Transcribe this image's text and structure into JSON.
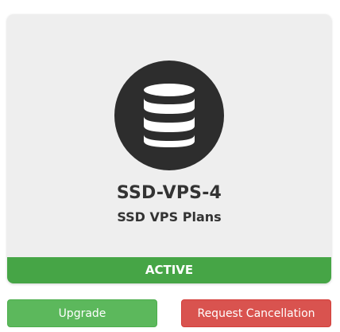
{
  "product": {
    "icon": "database-icon",
    "name": "SSD-VPS-4",
    "group": "SSD VPS Plans",
    "status": "ACTIVE"
  },
  "actions": {
    "upgrade_label": "Upgrade",
    "cancel_label": "Request Cancellation"
  },
  "colors": {
    "panel_bg": "#eeeeee",
    "icon_circle": "#2d2d2d",
    "status_active": "#46a546",
    "upgrade_button": "#5cb85c",
    "cancel_button": "#d9534f"
  }
}
